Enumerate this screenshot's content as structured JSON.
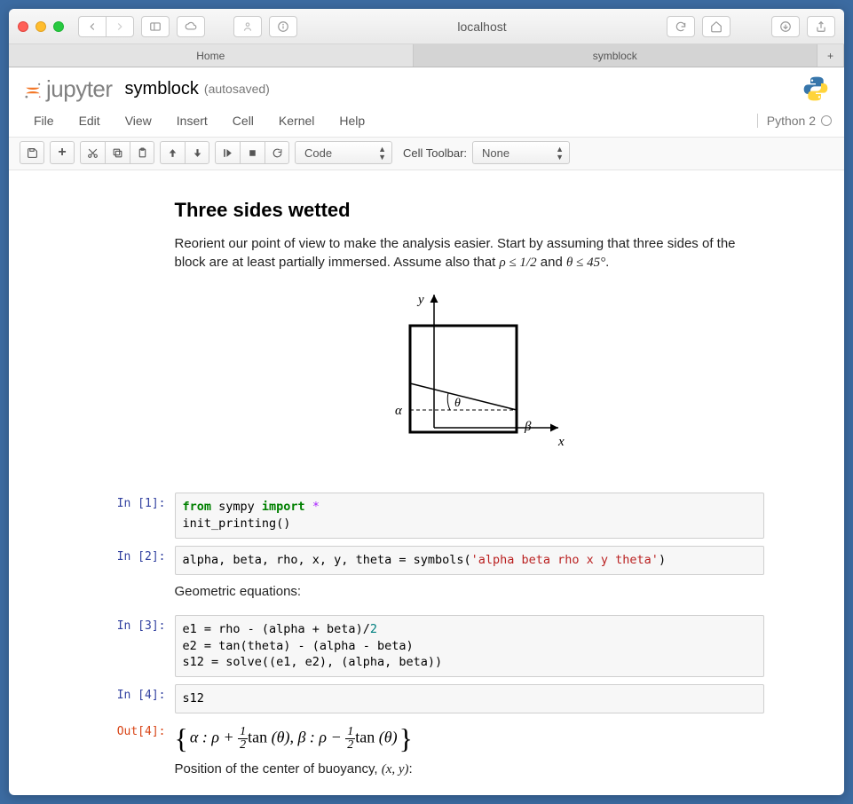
{
  "browser": {
    "address": "localhost",
    "tabs": [
      "Home",
      "symblock"
    ]
  },
  "jupyter": {
    "brand": "jupyter",
    "title": "symblock",
    "saved": "(autosaved)",
    "kernel": "Python 2"
  },
  "menu": {
    "items": [
      "File",
      "Edit",
      "View",
      "Insert",
      "Cell",
      "Kernel",
      "Help"
    ]
  },
  "toolbar": {
    "celltype": "Code",
    "celltoolbar_label": "Cell Toolbar:",
    "celltoolbar_value": "None"
  },
  "notebook": {
    "heading": "Three sides wetted",
    "intro_pre": "Reorient our point of view to make the analysis easier. Start by assuming that three sides of the block are at least partially immersed. Assume also that ",
    "intro_cond1": "ρ ≤ 1/2",
    "intro_and": " and ",
    "intro_cond2": "θ ≤ 45°",
    "intro_end": ".",
    "diagram_labels": {
      "x": "x",
      "y": "y",
      "alpha": "α",
      "beta": "β",
      "theta": "θ"
    },
    "text_geom": "Geometric equations:",
    "text_centroid_pre": "Position of the center of buoyancy, ",
    "text_centroid_xy": "(x, y)",
    "text_centroid_end": ":"
  },
  "cells": {
    "in1": "In [1]:",
    "c1_l1a": "from",
    "c1_l1b": " sympy ",
    "c1_l1c": "import",
    "c1_l1d": " *",
    "c1_l2": "init_printing()",
    "in2": "In [2]:",
    "c2_a": "alpha, beta, rho, x, y, theta = symbols(",
    "c2_b": "'alpha beta rho x y theta'",
    "c2_c": ")",
    "in3": "In [3]:",
    "c3_l1a": "e1 = rho - (alpha + beta)/",
    "c3_l1b": "2",
    "c3_l2": "e2 = tan(theta) - (alpha - beta)",
    "c3_l3": "s12 = solve((e1, e2), (alpha, beta))",
    "in4": "In [4]:",
    "c4": "s12",
    "out4": "Out[4]:"
  },
  "output4": {
    "alpha": "α",
    "rho": "ρ",
    "plus": " + ",
    "minus": " − ",
    "half_top": "1",
    "half_bot": "2",
    "tan": "tan",
    "theta": "θ",
    "beta": "β",
    "colon": " : ",
    "comma": ",    "
  }
}
